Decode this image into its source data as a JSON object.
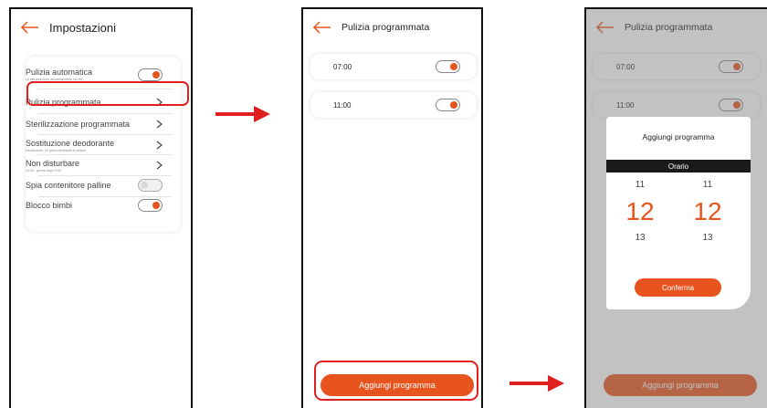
{
  "colors": {
    "accent": "#e8541e",
    "highlight": "#e0201e",
    "arrow": "#e0201e"
  },
  "screen1": {
    "title": "Impostazioni",
    "items": [
      {
        "label": "Pulizia automatica",
        "sub": "10 secondi dopo amazinamento nel WC",
        "control": "toggle",
        "on": true
      },
      {
        "label": "Pulizia programmata",
        "sub": "",
        "control": "chevron"
      },
      {
        "label": "Sterilizzazione programmata",
        "sub": "",
        "control": "chevron"
      },
      {
        "label": "Sostituzione deodorante",
        "sub": "Deodorante: 15 giorni rimanenti di utilizzo",
        "control": "chevron"
      },
      {
        "label": "Non disturbare",
        "sub": "22:00 - giorno dopo 9:00",
        "control": "chevron"
      },
      {
        "label": "Spia contenitore palline",
        "sub": "",
        "control": "toggle",
        "on": false
      },
      {
        "label": "Blocco bimbi",
        "sub": "",
        "control": "toggle",
        "on": true
      }
    ]
  },
  "screen2": {
    "title": "Pulizia programmata",
    "schedules": [
      {
        "time": "07:00",
        "on": true
      },
      {
        "time": "11:00",
        "on": true
      }
    ],
    "add_button": "Aggiungi programma"
  },
  "screen3": {
    "title": "Pulizia programmata",
    "schedules": [
      {
        "time": "07:00",
        "on": true
      },
      {
        "time": "11:00",
        "on": true
      }
    ],
    "modal": {
      "title": "Aggiungi programma",
      "header": "Orario",
      "hours": {
        "prev": "11",
        "current": "12",
        "next": "13"
      },
      "minutes": {
        "prev": "11",
        "current": "12",
        "next": "13"
      },
      "confirm": "Conferma"
    },
    "add_button": "Aggiungi programma"
  }
}
